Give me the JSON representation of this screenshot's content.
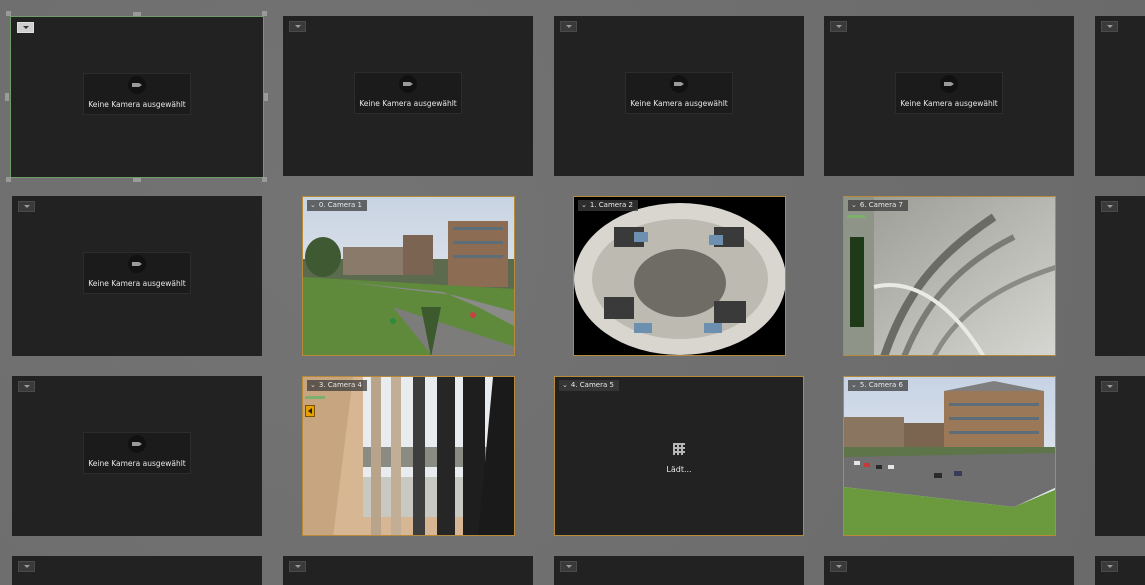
{
  "empty_tile_text": "Keine Kamera ausgewählt",
  "loading_text": "Lädt...",
  "cameras": {
    "cam1": "0. Camera 1",
    "cam2": "1. Camera 2",
    "cam7": "6. Camera 7",
    "cam4": "3. Camera 4",
    "cam5": "4. Camera 5",
    "cam6": "5. Camera 6"
  },
  "colors": {
    "background": "#6e6e6e",
    "tile": "#222222",
    "selected_border": "#6f9e6a",
    "camera_border": "#b68a3a"
  }
}
